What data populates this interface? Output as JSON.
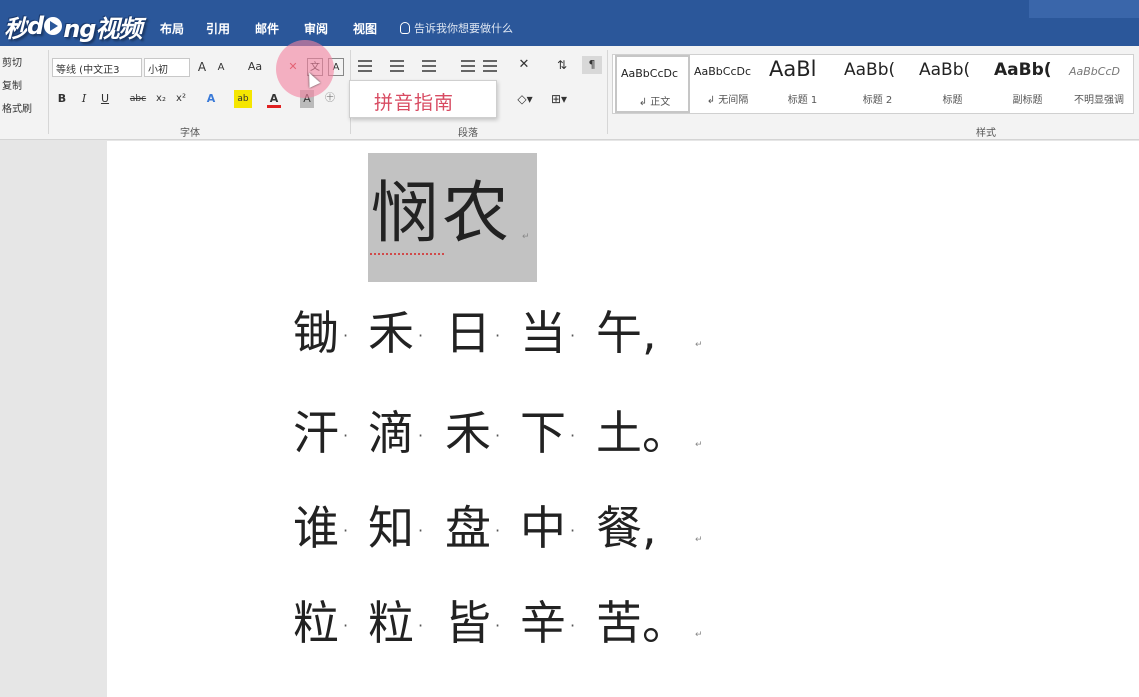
{
  "watermark": {
    "text_left": "秒",
    "text_mid": "d",
    "text_right": "ng视频"
  },
  "menu": {
    "layout": "布局",
    "references": "引用",
    "mailings": "邮件",
    "review": "审阅",
    "view": "视图",
    "tell_me": "告诉我你想要做什么"
  },
  "clipboard": {
    "cut": "剪切",
    "copy": "复制",
    "format_painter": "格式刷"
  },
  "font": {
    "family": "等线 (中文正3",
    "size": "小初",
    "grow": "A",
    "shrink": "A",
    "change_case": "Aa",
    "bold": "B",
    "italic": "I",
    "underline": "U",
    "strikethrough": "abc",
    "subscript": "x₂",
    "superscript": "x²",
    "text_effects": "A",
    "font_color": "A",
    "char_shading": "A",
    "group_label": "字体"
  },
  "paragraph": {
    "group_label": "段落"
  },
  "styles": {
    "group_label": "样式",
    "items": [
      {
        "sample": "AaBbCcDc",
        "name": "↲ 正文"
      },
      {
        "sample": "AaBbCcDc",
        "name": "↲ 无间隔"
      },
      {
        "sample": "AaBl",
        "name": "标题 1"
      },
      {
        "sample": "AaBb(",
        "name": "标题 2"
      },
      {
        "sample": "AaBb(",
        "name": "标题"
      },
      {
        "sample": "AaBb(",
        "name": "副标题"
      },
      {
        "sample": "AaBbCcD",
        "name": "不明显强调"
      }
    ]
  },
  "tooltip": {
    "text": "拼音指南"
  },
  "document": {
    "title": "悯农",
    "lines": [
      {
        "chars": [
          "锄",
          "禾",
          "日",
          "当",
          "午,"
        ]
      },
      {
        "chars": [
          "汗",
          "滴",
          "禾",
          "下",
          "土。"
        ]
      },
      {
        "chars": [
          "谁",
          "知",
          "盘",
          "中",
          "餐,"
        ]
      },
      {
        "chars": [
          "粒",
          "粒",
          "皆",
          "辛",
          "苦。"
        ]
      }
    ],
    "para_mark": "↵",
    "space_mark": "·"
  },
  "colors": {
    "ribbon_blue": "#2b579a",
    "tooltip_text": "#d84b62",
    "selection": "#c2c2c2"
  }
}
